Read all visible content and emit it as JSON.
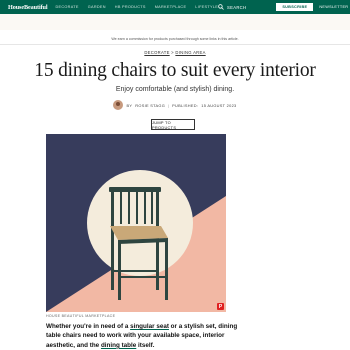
{
  "nav": {
    "logo": "HouseBeautiful",
    "links": [
      "DECORATE",
      "GARDEN",
      "HB PRODUCTS",
      "MARKETPLACE",
      "LIFESTYLE"
    ],
    "search_label": "SEARCH",
    "subscribe_label": "SUBSCRIBE",
    "newsletter_label": "NEWSLETTER",
    "brand_color": "#00634f"
  },
  "commission_notice": "We earn a commission for products purchased through some links in this article.",
  "breadcrumb": {
    "section": "DECORATE",
    "separator": ">",
    "subsection": "DINING AREA"
  },
  "article": {
    "title": "15 dining chairs to suit every interior",
    "dek": "Enjoy comfortable (and stylish) dining.",
    "byline": {
      "prefix": "BY",
      "author": "ROSIE STAGG",
      "separator": "|",
      "published_label": "PUBLISHED:",
      "date": "15 AUGUST 2023"
    },
    "jump_button": "JUMP TO PRODUCTS",
    "image_credit": "HOUSE BEAUTIFUL MARKETPLACE",
    "pinterest_icon": "pinterest-icon",
    "body": {
      "p1_a": "Whether you're in need of a ",
      "p1_link1": "singular seat",
      "p1_b": " or a stylish set, dining table chairs need to work with your available space, interior aesthetic, and the ",
      "p1_link2": "dining table",
      "p1_c": " itself."
    },
    "hero_colors": {
      "navy": "#373c5c",
      "pink": "#f2b8a4",
      "cream": "#f4ecdc",
      "chair": "#2e4540",
      "seat": "#c9a878"
    }
  }
}
